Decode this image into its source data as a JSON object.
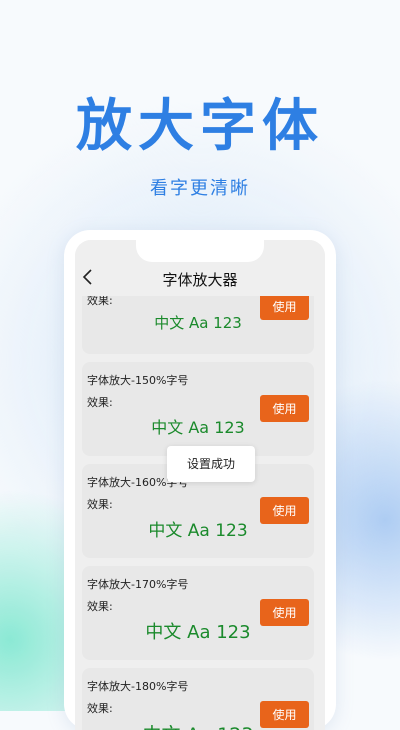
{
  "hero": {
    "title": "放大字体",
    "subtitle": "看字更清晰"
  },
  "app": {
    "page_title": "字体放大器",
    "toast": "设置成功",
    "use_label": "使用",
    "effect_label": "效果:",
    "sample_text": "中文 Aa 123",
    "cards": [
      {
        "title": "",
        "effect": "效果:"
      },
      {
        "title": "字体放大-150%字号",
        "effect": "效果:"
      },
      {
        "title": "字体放大-160%字号",
        "effect": "效果:"
      },
      {
        "title": "字体放大-170%字号",
        "effect": "效果:"
      },
      {
        "title": "字体放大-180%字号",
        "effect": "效果:"
      }
    ]
  },
  "colors": {
    "brand_blue": "#2e7fe3",
    "button_orange": "#e8641b",
    "sample_green": "#1b8a2c"
  }
}
